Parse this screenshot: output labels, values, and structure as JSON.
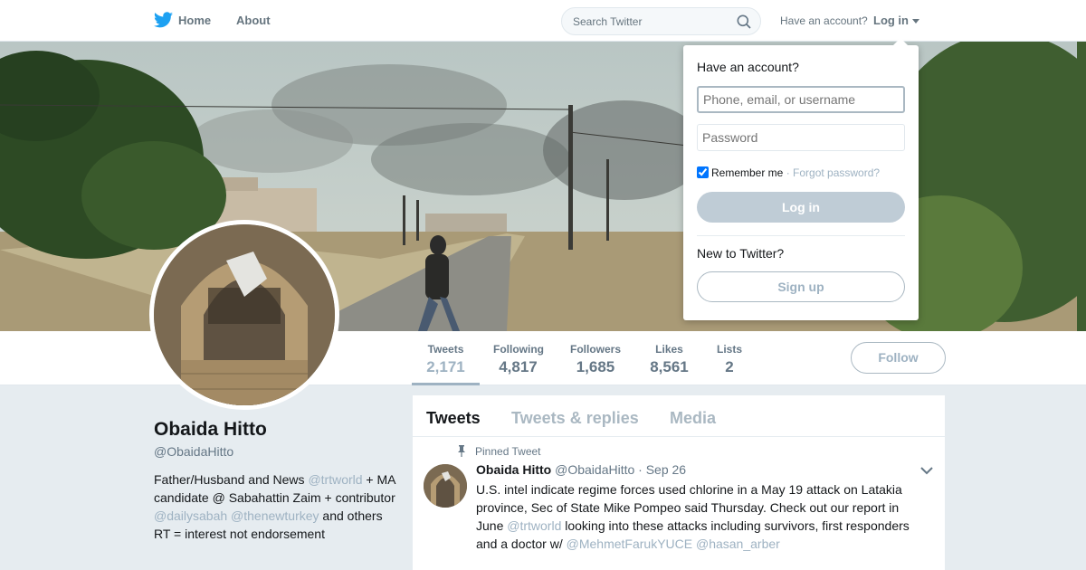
{
  "nav": {
    "home": "Home",
    "about": "About",
    "search_placeholder": "Search Twitter",
    "have_account": "Have an account?",
    "login": "Log in"
  },
  "profile": {
    "name": "Obaida Hitto",
    "handle": "@ObaidaHitto",
    "bio": [
      {
        "t": "Father/Husband and News ",
        "m": false
      },
      {
        "t": "@trtworld",
        "m": true
      },
      {
        "t": " + MA candidate @ Sabahattin Zaim + contributor ",
        "m": false
      },
      {
        "t": "@dailysabah",
        "m": true
      },
      {
        "t": " ",
        "m": false
      },
      {
        "t": "@thenewturkey",
        "m": true
      },
      {
        "t": " and others RT = interest not endorsement",
        "m": false
      }
    ],
    "follow_label": "Follow"
  },
  "stats": [
    {
      "label": "Tweets",
      "value": "2,171",
      "active": true
    },
    {
      "label": "Following",
      "value": "4,817",
      "active": false
    },
    {
      "label": "Followers",
      "value": "1,685",
      "active": false
    },
    {
      "label": "Likes",
      "value": "8,561",
      "active": false
    },
    {
      "label": "Lists",
      "value": "2",
      "active": false
    }
  ],
  "timeline": {
    "tabs": [
      "Tweets",
      "Tweets & replies",
      "Media"
    ],
    "active_tab": 0,
    "pinned_label": "Pinned Tweet",
    "tweet": {
      "name": "Obaida Hitto",
      "handle": "@ObaidaHitto",
      "date": "· Sep 26",
      "text": [
        {
          "t": "U.S. intel indicate regime forces used chlorine in a May 19 attack on Latakia province, Sec of State Mike Pompeo said Thursday.  Check out our report in June ",
          "m": false
        },
        {
          "t": "@trtworld",
          "m": true
        },
        {
          "t": " looking into these attacks including survivors, first responders and a doctor w/ ",
          "m": false
        },
        {
          "t": "@MehmetFarukYUCE",
          "m": true
        },
        {
          "t": " ",
          "m": false
        },
        {
          "t": "@hasan_arber",
          "m": true
        }
      ]
    }
  },
  "login_dropdown": {
    "title": "Have an account?",
    "username_placeholder": "Phone, email, or username",
    "password_placeholder": "Password",
    "remember_me": "Remember me",
    "separator": " · ",
    "forgot_password": "Forgot password?",
    "login_button": "Log in",
    "new_to_twitter": "New to Twitter?",
    "signup_button": "Sign up"
  },
  "colors": {
    "twitter_blue": "#1da1f2",
    "muted_link": "#9eb2c2",
    "button_disabled": "#bfccd6",
    "background": "#e6ecf0"
  },
  "icons": [
    "twitter-bird-icon",
    "search-icon",
    "caret-down-icon",
    "pin-icon",
    "chevron-down-icon"
  ]
}
